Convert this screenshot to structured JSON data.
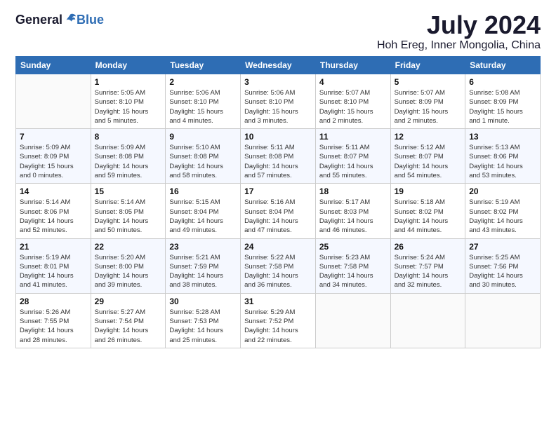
{
  "logo": {
    "general": "General",
    "blue": "Blue"
  },
  "header": {
    "month_year": "July 2024",
    "location": "Hoh Ereg, Inner Mongolia, China"
  },
  "weekdays": [
    "Sunday",
    "Monday",
    "Tuesday",
    "Wednesday",
    "Thursday",
    "Friday",
    "Saturday"
  ],
  "weeks": [
    [
      {
        "day": "",
        "info": ""
      },
      {
        "day": "1",
        "info": "Sunrise: 5:05 AM\nSunset: 8:10 PM\nDaylight: 15 hours\nand 5 minutes."
      },
      {
        "day": "2",
        "info": "Sunrise: 5:06 AM\nSunset: 8:10 PM\nDaylight: 15 hours\nand 4 minutes."
      },
      {
        "day": "3",
        "info": "Sunrise: 5:06 AM\nSunset: 8:10 PM\nDaylight: 15 hours\nand 3 minutes."
      },
      {
        "day": "4",
        "info": "Sunrise: 5:07 AM\nSunset: 8:10 PM\nDaylight: 15 hours\nand 2 minutes."
      },
      {
        "day": "5",
        "info": "Sunrise: 5:07 AM\nSunset: 8:09 PM\nDaylight: 15 hours\nand 2 minutes."
      },
      {
        "day": "6",
        "info": "Sunrise: 5:08 AM\nSunset: 8:09 PM\nDaylight: 15 hours\nand 1 minute."
      }
    ],
    [
      {
        "day": "7",
        "info": "Sunrise: 5:09 AM\nSunset: 8:09 PM\nDaylight: 15 hours\nand 0 minutes."
      },
      {
        "day": "8",
        "info": "Sunrise: 5:09 AM\nSunset: 8:08 PM\nDaylight: 14 hours\nand 59 minutes."
      },
      {
        "day": "9",
        "info": "Sunrise: 5:10 AM\nSunset: 8:08 PM\nDaylight: 14 hours\nand 58 minutes."
      },
      {
        "day": "10",
        "info": "Sunrise: 5:11 AM\nSunset: 8:08 PM\nDaylight: 14 hours\nand 57 minutes."
      },
      {
        "day": "11",
        "info": "Sunrise: 5:11 AM\nSunset: 8:07 PM\nDaylight: 14 hours\nand 55 minutes."
      },
      {
        "day": "12",
        "info": "Sunrise: 5:12 AM\nSunset: 8:07 PM\nDaylight: 14 hours\nand 54 minutes."
      },
      {
        "day": "13",
        "info": "Sunrise: 5:13 AM\nSunset: 8:06 PM\nDaylight: 14 hours\nand 53 minutes."
      }
    ],
    [
      {
        "day": "14",
        "info": "Sunrise: 5:14 AM\nSunset: 8:06 PM\nDaylight: 14 hours\nand 52 minutes."
      },
      {
        "day": "15",
        "info": "Sunrise: 5:14 AM\nSunset: 8:05 PM\nDaylight: 14 hours\nand 50 minutes."
      },
      {
        "day": "16",
        "info": "Sunrise: 5:15 AM\nSunset: 8:04 PM\nDaylight: 14 hours\nand 49 minutes."
      },
      {
        "day": "17",
        "info": "Sunrise: 5:16 AM\nSunset: 8:04 PM\nDaylight: 14 hours\nand 47 minutes."
      },
      {
        "day": "18",
        "info": "Sunrise: 5:17 AM\nSunset: 8:03 PM\nDaylight: 14 hours\nand 46 minutes."
      },
      {
        "day": "19",
        "info": "Sunrise: 5:18 AM\nSunset: 8:02 PM\nDaylight: 14 hours\nand 44 minutes."
      },
      {
        "day": "20",
        "info": "Sunrise: 5:19 AM\nSunset: 8:02 PM\nDaylight: 14 hours\nand 43 minutes."
      }
    ],
    [
      {
        "day": "21",
        "info": "Sunrise: 5:19 AM\nSunset: 8:01 PM\nDaylight: 14 hours\nand 41 minutes."
      },
      {
        "day": "22",
        "info": "Sunrise: 5:20 AM\nSunset: 8:00 PM\nDaylight: 14 hours\nand 39 minutes."
      },
      {
        "day": "23",
        "info": "Sunrise: 5:21 AM\nSunset: 7:59 PM\nDaylight: 14 hours\nand 38 minutes."
      },
      {
        "day": "24",
        "info": "Sunrise: 5:22 AM\nSunset: 7:58 PM\nDaylight: 14 hours\nand 36 minutes."
      },
      {
        "day": "25",
        "info": "Sunrise: 5:23 AM\nSunset: 7:58 PM\nDaylight: 14 hours\nand 34 minutes."
      },
      {
        "day": "26",
        "info": "Sunrise: 5:24 AM\nSunset: 7:57 PM\nDaylight: 14 hours\nand 32 minutes."
      },
      {
        "day": "27",
        "info": "Sunrise: 5:25 AM\nSunset: 7:56 PM\nDaylight: 14 hours\nand 30 minutes."
      }
    ],
    [
      {
        "day": "28",
        "info": "Sunrise: 5:26 AM\nSunset: 7:55 PM\nDaylight: 14 hours\nand 28 minutes."
      },
      {
        "day": "29",
        "info": "Sunrise: 5:27 AM\nSunset: 7:54 PM\nDaylight: 14 hours\nand 26 minutes."
      },
      {
        "day": "30",
        "info": "Sunrise: 5:28 AM\nSunset: 7:53 PM\nDaylight: 14 hours\nand 25 minutes."
      },
      {
        "day": "31",
        "info": "Sunrise: 5:29 AM\nSunset: 7:52 PM\nDaylight: 14 hours\nand 22 minutes."
      },
      {
        "day": "",
        "info": ""
      },
      {
        "day": "",
        "info": ""
      },
      {
        "day": "",
        "info": ""
      }
    ]
  ]
}
